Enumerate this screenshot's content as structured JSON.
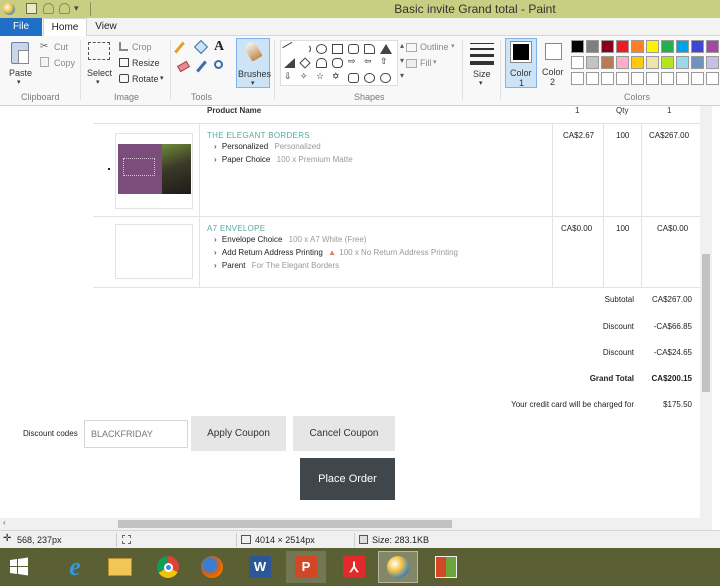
{
  "window": {
    "title": "Basic invite Grand total - Paint"
  },
  "tabs": [
    {
      "label": "File"
    },
    {
      "label": "Home"
    },
    {
      "label": "View"
    }
  ],
  "ribbon": {
    "paste": "Paste",
    "cut": "Cut",
    "copy": "Copy",
    "select": "Select",
    "crop": "Crop",
    "resize": "Resize",
    "rotate": "Rotate",
    "brushes": "Brushes",
    "outline": "Outline",
    "fill": "Fill",
    "size": "Size",
    "color1": "Color",
    "color1_n": "1",
    "color2": "Color",
    "color2_n": "2",
    "groups": {
      "clipboard": "Clipboard",
      "image": "Image",
      "tools": "Tools",
      "shapes": "Shapes",
      "colors": "Colors"
    },
    "palette": {
      "row1": [
        "#000000",
        "#7f7f7f",
        "#880015",
        "#ed1c24",
        "#ff7f27",
        "#fff200",
        "#22b14c",
        "#00a2e8",
        "#3f48cc",
        "#a349a4"
      ],
      "row2": [
        "#ffffff",
        "#c3c3c3",
        "#b97a57",
        "#ffaec9",
        "#ffc90e",
        "#efe4b0",
        "#b5e61d",
        "#99d9ea",
        "#7092be",
        "#c8bfe7"
      ],
      "row3": [
        "#ffffff",
        "#ffffff",
        "#ffffff",
        "#ffffff",
        "#ffffff",
        "#ffffff",
        "#ffffff",
        "#ffffff",
        "#ffffff",
        "#ffffff"
      ]
    }
  },
  "order": {
    "header": {
      "product": "Product Name",
      "price_num": "1",
      "qty": "Qty",
      "total_num": "1"
    },
    "items": [
      {
        "name": "THE ELEGANT BORDERS",
        "options": [
          {
            "label": "Personalized",
            "value": "Personalized"
          },
          {
            "label": "Paper Choice",
            "value": "100 x Premium Matte"
          }
        ],
        "price": "CA$2.67",
        "qty": "100",
        "total": "CA$267.00"
      },
      {
        "name": "A7 ENVELOPE",
        "options": [
          {
            "label": "Envelope Choice",
            "value": "100 x A7 White (Free)"
          },
          {
            "label": "Add Return Address Printing",
            "value": "100 x No Return Address Printing"
          },
          {
            "label": "Parent",
            "value": "For The Elegant Borders"
          }
        ],
        "price": "CA$0.00",
        "qty": "100",
        "total": "CA$0.00"
      }
    ],
    "summary": [
      {
        "label": "Subtotal",
        "value": "CA$267.00"
      },
      {
        "label": "Discount",
        "value": "-CA$66.85"
      },
      {
        "label": "Discount",
        "value": "-CA$24.65"
      },
      {
        "label": "Grand Total",
        "value": "CA$200.15"
      },
      {
        "label": "Your credit card will be charged for",
        "value": "$175.50"
      }
    ],
    "discount": {
      "label": "Discount codes",
      "value": "BLACKFRIDAY",
      "apply": "Apply Coupon",
      "cancel": "Cancel Coupon"
    },
    "place_order": "Place Order"
  },
  "status": {
    "cursor": "568, 237px",
    "dimensions": "4014 × 2514px",
    "size": "Size: 283.1KB"
  },
  "colors": {
    "titlebar": "#c9ce82",
    "file_tab": "#1e6fc5",
    "taskbar": "#5a5f34",
    "item_name": "#5aa9a0",
    "place_order_bg": "#3f474d"
  }
}
